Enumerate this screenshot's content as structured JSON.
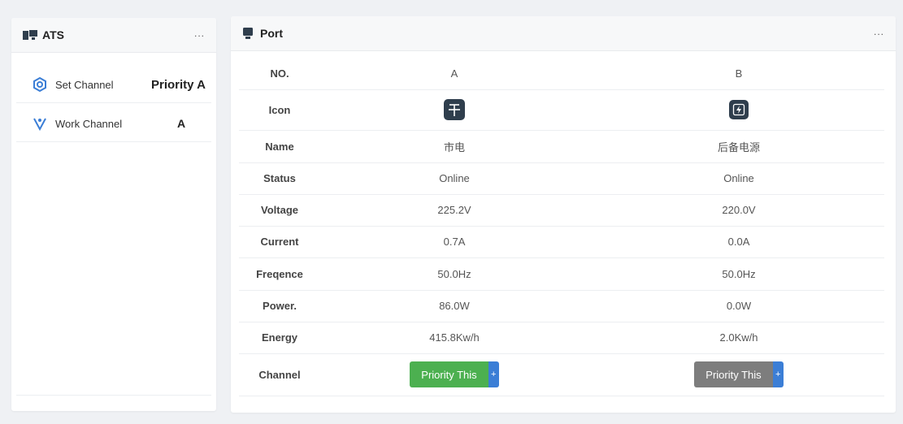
{
  "ats": {
    "title": "ATS",
    "more": "...",
    "rows": [
      {
        "label": "Set Channel",
        "value": "Priority A",
        "icon": "settings-icon"
      },
      {
        "label": "Work Channel",
        "value": "A",
        "icon": "antenna-icon"
      }
    ]
  },
  "port": {
    "title": "Port",
    "more": "...",
    "labels": {
      "no": "NO.",
      "icon": "Icon",
      "name": "Name",
      "status": "Status",
      "voltage": "Voltage",
      "current": "Current",
      "frequence": "Freqence",
      "power": "Power.",
      "energy": "Energy",
      "channel": "Channel"
    },
    "columns": [
      {
        "no": "A",
        "icon": "power-grid-icon",
        "name": "市电",
        "status": "Online",
        "voltage": "225.2V",
        "current": "0.7A",
        "frequence": "50.0Hz",
        "power": "86.0W",
        "energy": "415.8Kw/h",
        "button": {
          "label": "Priority This",
          "plus": "+",
          "color": "#4cb050"
        }
      },
      {
        "no": "B",
        "icon": "battery-power-icon",
        "name": "后备电源",
        "status": "Online",
        "voltage": "220.0V",
        "current": "0.0A",
        "frequence": "50.0Hz",
        "power": "0.0W",
        "energy": "2.0Kw/h",
        "button": {
          "label": "Priority This",
          "plus": "+",
          "color": "#7d7d7d"
        }
      }
    ]
  },
  "colors": {
    "accent_blue": "#3b7ed6",
    "green": "#4cb050",
    "gray": "#7d7d7d",
    "icon_dark": "#2f3e4d"
  }
}
